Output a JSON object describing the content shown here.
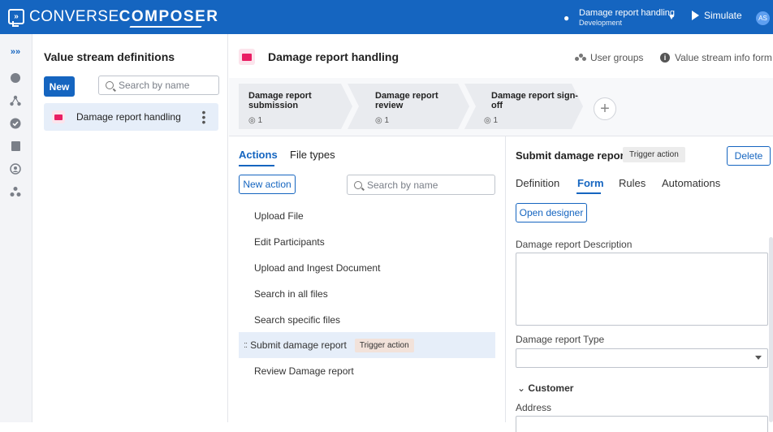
{
  "app": {
    "logo_light": "CONVERSE",
    "logo_bold": "COMPOSER",
    "logo_mark": "»",
    "environment_title": "Damage report handling",
    "environment_sub": "Development",
    "simulate_label": "Simulate",
    "avatar_initials": "AS",
    "accent_color": "#1565c0"
  },
  "rail": {
    "icons": [
      "expand-icon",
      "globe-icon",
      "workflow-icon",
      "check-circle-icon",
      "book-icon",
      "support-icon",
      "people-icon"
    ]
  },
  "value_streams": {
    "title": "Value stream definitions",
    "new_label": "New",
    "search_placeholder": "Search by name",
    "items": [
      {
        "label": "Damage report handling"
      }
    ]
  },
  "header": {
    "title": "Damage report handling",
    "user_groups_label": "User groups",
    "info_form_label": "Value stream info form"
  },
  "stages": [
    {
      "line1": "Damage report",
      "line2": "submission",
      "count": "1"
    },
    {
      "line1": "Damage report",
      "line2": "review",
      "count": "1"
    },
    {
      "line1": "Damage report sign-",
      "line2": "off",
      "count": "1"
    }
  ],
  "actions_panel": {
    "tabs": [
      "Actions",
      "File types"
    ],
    "new_action_label": "New action",
    "search_placeholder": "Search by name",
    "items": [
      {
        "label": "Upload File"
      },
      {
        "label": "Edit Participants"
      },
      {
        "label": "Upload and Ingest Document"
      },
      {
        "label": "Search in all files"
      },
      {
        "label": "Search specific files"
      },
      {
        "label": "Submit damage report",
        "chip": "Trigger action",
        "drag": "::"
      },
      {
        "label": "Review Damage report"
      }
    ]
  },
  "detail": {
    "title": "Submit damage report",
    "chip": "Trigger action",
    "delete_label": "Delete",
    "tabs": [
      "Definition",
      "Form",
      "Rules",
      "Automations"
    ],
    "open_designer_label": "Open designer",
    "fields": {
      "description_label": "Damage report Description",
      "type_label": "Damage report Type",
      "customer_section": "Customer",
      "address_label": "Address"
    }
  }
}
